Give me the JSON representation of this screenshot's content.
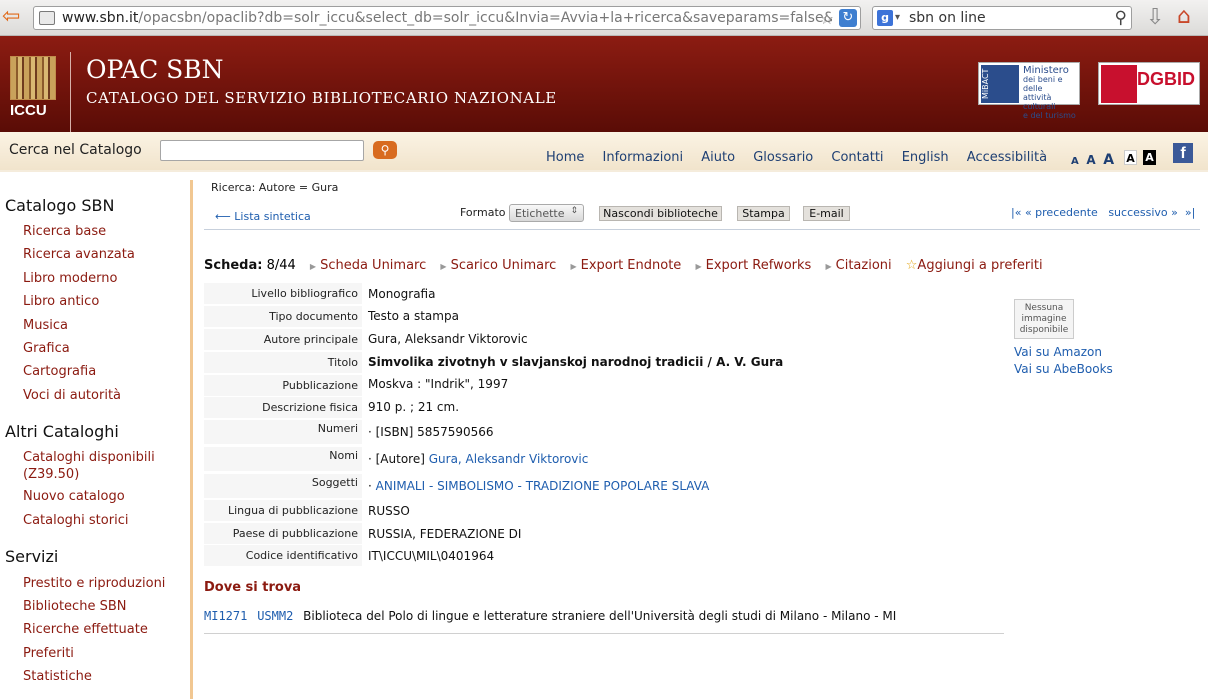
{
  "browser": {
    "url_host": "www.sbn.it",
    "url_rest": "/opacsbn/opaclib?db=solr_iccu&select_db=solr_iccu&Invia=Avvia+la+ricerca&saveparams=false&r",
    "search_query": "sbn on line",
    "engine_letter": "g"
  },
  "header": {
    "logo_text": "ICCU",
    "title": "OPAC SBN",
    "subtitle": "CATALOGO DEL SERVIZIO BIBLIOTECARIO NAZIONALE",
    "mibac_label": "MiBACT",
    "mibac_lines": [
      "Ministero",
      "dei beni e delle",
      "attività culturali",
      "e del turismo"
    ],
    "dgbid_text": "DGBID",
    "dgbid_side": "MiBAC"
  },
  "navbar": {
    "search_label": "Cerca nel Catalogo",
    "links": [
      "Home",
      "Informazioni",
      "Aiuto",
      "Glossario",
      "Contatti",
      "English",
      "Accessibilità"
    ],
    "font_sizes": [
      "A",
      "A",
      "A"
    ],
    "contrast_buttons": [
      "A",
      "A"
    ],
    "facebook": "f"
  },
  "sidebar": {
    "catalogo_title": "Catalogo SBN",
    "catalogo_items": [
      "Ricerca base",
      "Ricerca avanzata",
      "Libro moderno",
      "Libro antico",
      "Musica",
      "Grafica",
      "Cartografia",
      "Voci di autorità"
    ],
    "altri_title": "Altri Cataloghi",
    "altri_items": [
      "Cataloghi disponibili",
      "(Z39.50)",
      "Nuovo catalogo",
      "Cataloghi storici"
    ],
    "servizi_title": "Servizi",
    "servizi_items": [
      "Prestito e riproduzioni",
      "Biblioteche SBN",
      "Ricerche effettuate",
      "Preferiti",
      "Statistiche"
    ]
  },
  "toolbar": {
    "breadcrumb": "Ricerca: Autore = Gura",
    "back_link": "Lista sintetica",
    "format_label": "Formato",
    "format_value": "Etichette",
    "btn_hide": "Nascondi biblioteche",
    "btn_print": "Stampa",
    "btn_email": "E-mail",
    "first": "|«",
    "prev_arrow": "«",
    "prev": "precedente",
    "next": "successivo",
    "next_arrow": "»",
    "last": "»|"
  },
  "actions": {
    "scheda_label": "Scheda:",
    "scheda_pos": "8/44",
    "links": [
      "Scheda Unimarc",
      "Scarico Unimarc",
      "Export Endnote",
      "Export Refworks",
      "Citazioni"
    ],
    "favorite": "Aggiungi a preferiti"
  },
  "record": {
    "livello_k": "Livello bibliografico",
    "livello_v": "Monografia",
    "tipo_k": "Tipo documento",
    "tipo_v": "Testo a stampa",
    "autore_k": "Autore principale",
    "autore_v": "Gura, Aleksandr Viktorovic",
    "titolo_k": "Titolo",
    "titolo_v": "Simvolika zivotnyh v slavjanskoj narodnoj tradicii / A. V. Gura",
    "pubbl_k": "Pubblicazione",
    "pubbl_v": "Moskva : \"Indrik\", 1997",
    "descr_k": "Descrizione fisica",
    "descr_v": "910 p. ; 21 cm.",
    "numeri_k": "Numeri",
    "numeri_v": "· [ISBN] 5857590566",
    "nomi_k": "Nomi",
    "nomi_pre": "· [Autore] ",
    "nomi_link": "Gura, Aleksandr Viktorovic",
    "sogg_k": "Soggetti",
    "sogg_pre": "· ",
    "sogg_link": "ANIMALI - SIMBOLISMO - TRADIZIONE POPOLARE SLAVA",
    "lingua_k": "Lingua di pubblicazione",
    "lingua_v": "RUSSO",
    "paese_k": "Paese di pubblicazione",
    "paese_v": "RUSSIA, FEDERAZIONE DI",
    "codice_k": "Codice identificativo",
    "codice_v": "IT\\ICCU\\MIL\\0401964"
  },
  "side_panel": {
    "no_image": [
      "Nessuna",
      "immagine",
      "disponibile"
    ],
    "amazon": "Vai su Amazon",
    "abebooks": "Vai su AbeBooks"
  },
  "location": {
    "title": "Dove si trova",
    "code1": "MI1271",
    "code2": "USMM2",
    "library": "Biblioteca del Polo di lingue e letterature straniere dell'Università degli studi di Milano - Milano - MI"
  }
}
